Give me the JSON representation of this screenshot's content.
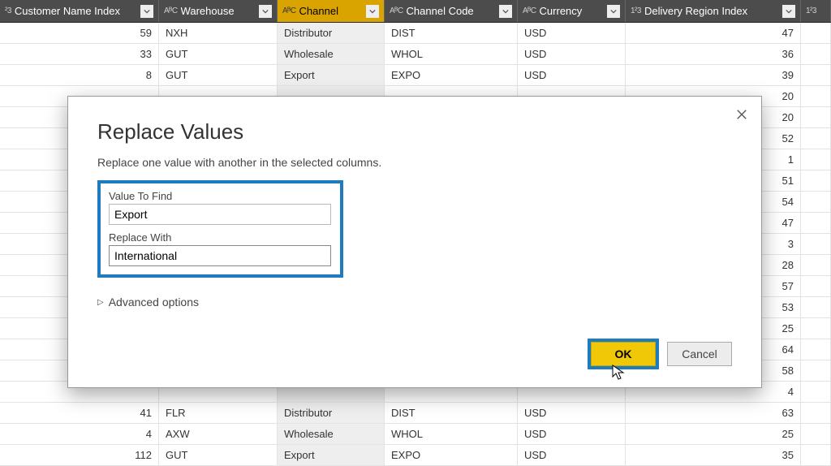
{
  "columns": [
    {
      "label": "Customer Name Index",
      "type_icon": "1²3",
      "selected": false,
      "partial_prefix": true
    },
    {
      "label": "Warehouse",
      "type_icon": "AᴮC",
      "selected": false
    },
    {
      "label": "Channel",
      "type_icon": "AᴮC",
      "selected": true
    },
    {
      "label": "Channel Code",
      "type_icon": "AᴮC",
      "selected": false
    },
    {
      "label": "Currency",
      "type_icon": "AᴮC",
      "selected": false
    },
    {
      "label": "Delivery Region Index",
      "type_icon": "1²3",
      "selected": false
    },
    {
      "label": "",
      "type_icon": "1²3",
      "selected": false,
      "partial": true
    }
  ],
  "rows": [
    {
      "idx": "59",
      "wh": "NXH",
      "ch": "Distributor",
      "code": "DIST",
      "cur": "USD",
      "reg": "47"
    },
    {
      "idx": "33",
      "wh": "GUT",
      "ch": "Wholesale",
      "code": "WHOL",
      "cur": "USD",
      "reg": "36"
    },
    {
      "idx": "8",
      "wh": "GUT",
      "ch": "Export",
      "code": "EXPO",
      "cur": "USD",
      "reg": "39"
    },
    {
      "idx": "",
      "wh": "",
      "ch": "",
      "code": "",
      "cur": "",
      "reg": "20"
    },
    {
      "idx": "",
      "wh": "",
      "ch": "",
      "code": "",
      "cur": "",
      "reg": "20"
    },
    {
      "idx": "",
      "wh": "",
      "ch": "",
      "code": "",
      "cur": "",
      "reg": "52"
    },
    {
      "idx": "",
      "wh": "",
      "ch": "",
      "code": "",
      "cur": "",
      "reg": "1"
    },
    {
      "idx": "",
      "wh": "",
      "ch": "",
      "code": "",
      "cur": "",
      "reg": "51"
    },
    {
      "idx": "",
      "wh": "",
      "ch": "",
      "code": "",
      "cur": "",
      "reg": "54"
    },
    {
      "idx": "",
      "wh": "",
      "ch": "",
      "code": "",
      "cur": "",
      "reg": "47"
    },
    {
      "idx": "",
      "wh": "",
      "ch": "",
      "code": "",
      "cur": "",
      "reg": "3"
    },
    {
      "idx": "",
      "wh": "",
      "ch": "",
      "code": "",
      "cur": "",
      "reg": "28"
    },
    {
      "idx": "",
      "wh": "",
      "ch": "",
      "code": "",
      "cur": "",
      "reg": "57"
    },
    {
      "idx": "",
      "wh": "",
      "ch": "",
      "code": "",
      "cur": "",
      "reg": "53"
    },
    {
      "idx": "",
      "wh": "",
      "ch": "",
      "code": "",
      "cur": "",
      "reg": "25"
    },
    {
      "idx": "",
      "wh": "",
      "ch": "",
      "code": "",
      "cur": "",
      "reg": "64"
    },
    {
      "idx": "",
      "wh": "",
      "ch": "",
      "code": "",
      "cur": "",
      "reg": "58"
    },
    {
      "idx": "",
      "wh": "",
      "ch": "",
      "code": "",
      "cur": "",
      "reg": "4"
    },
    {
      "idx": "41",
      "wh": "FLR",
      "ch": "Distributor",
      "code": "DIST",
      "cur": "USD",
      "reg": "63"
    },
    {
      "idx": "4",
      "wh": "AXW",
      "ch": "Wholesale",
      "code": "WHOL",
      "cur": "USD",
      "reg": "25"
    },
    {
      "idx": "112",
      "wh": "GUT",
      "ch": "Export",
      "code": "EXPO",
      "cur": "USD",
      "reg": "35"
    }
  ],
  "dialog": {
    "title": "Replace Values",
    "subtitle": "Replace one value with another in the selected columns.",
    "value_to_find_label": "Value To Find",
    "value_to_find_value": "Export",
    "replace_with_label": "Replace With",
    "replace_with_value": "International",
    "advanced_options": "Advanced options",
    "ok_label": "OK",
    "cancel_label": "Cancel"
  }
}
